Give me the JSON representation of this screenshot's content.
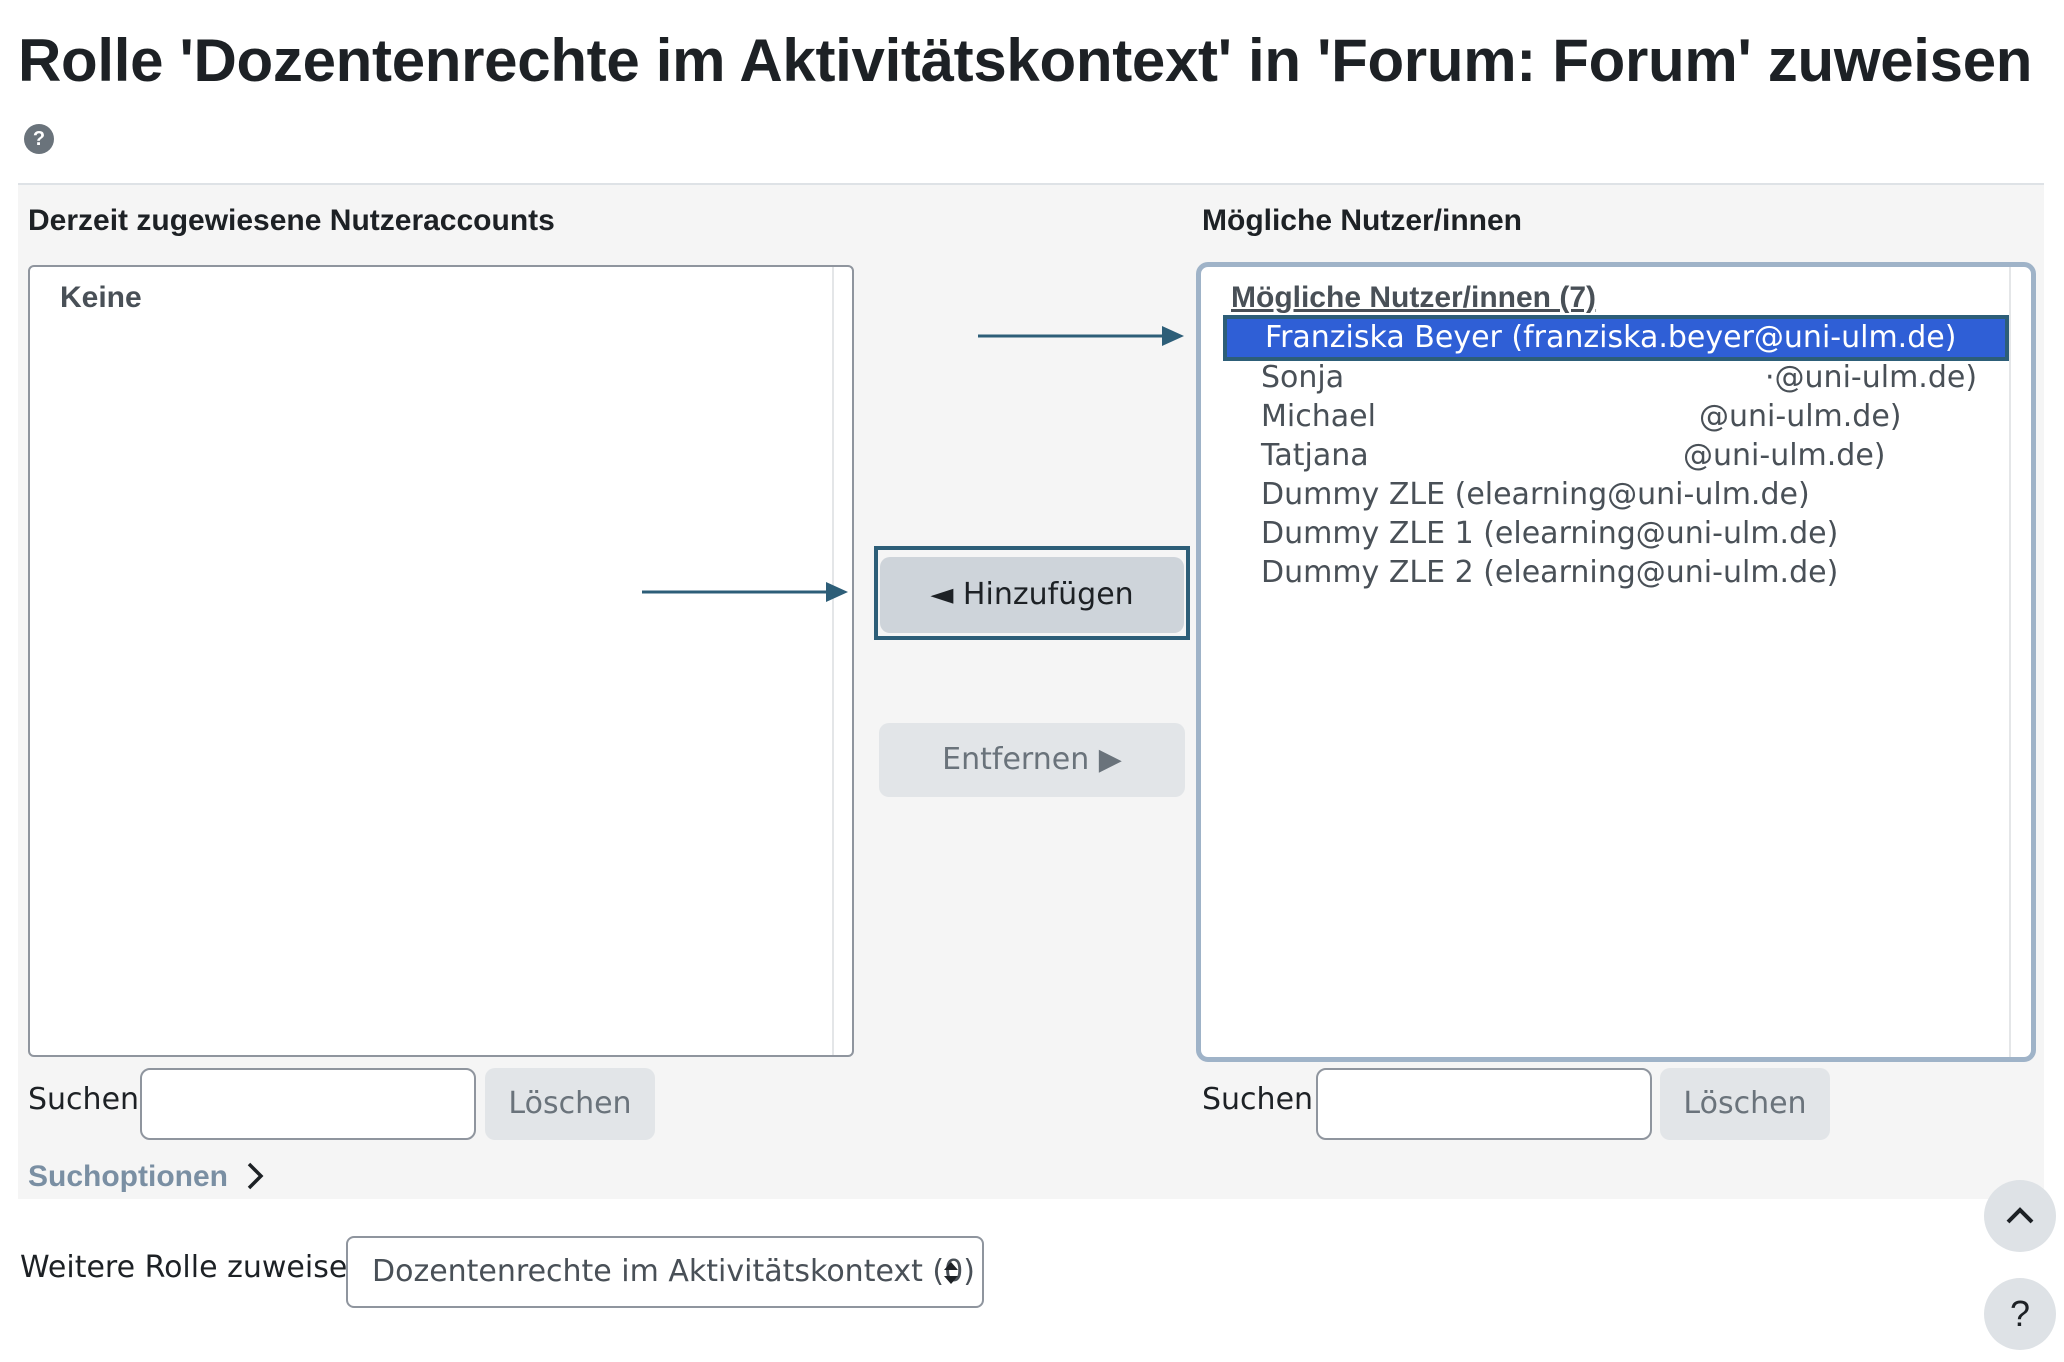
{
  "page": {
    "title": "Rolle 'Dozentenrechte im Aktivitätskontext' in 'Forum: Forum' zuweisen",
    "help_glyph": "?"
  },
  "current_users": {
    "heading": "Derzeit zugewiesene Nutzeraccounts",
    "empty_text": "Keine",
    "search_label": "Suchen",
    "search_value": "",
    "clear_label": "Löschen"
  },
  "potential_users": {
    "heading": "Mögliche Nutzer/innen",
    "group_label": "Mögliche Nutzer/innen (7)",
    "items": [
      {
        "name": "Franziska Beyer (franziska.beyer@uni-ulm.de)",
        "email": "",
        "selected": true
      },
      {
        "name": "Sonja",
        "email": "·@uni-ulm.de)",
        "selected": false
      },
      {
        "name": "Michael",
        "email": "@uni-ulm.de)",
        "selected": false
      },
      {
        "name": "Tatjana",
        "email": "@uni-ulm.de)",
        "selected": false
      },
      {
        "name": "Dummy ZLE (elearning@uni-ulm.de)",
        "email": "",
        "selected": false
      },
      {
        "name": "Dummy ZLE 1 (elearning@uni-ulm.de)",
        "email": "",
        "selected": false
      },
      {
        "name": "Dummy ZLE 2 (elearning@uni-ulm.de)",
        "email": "",
        "selected": false
      }
    ],
    "search_label": "Suchen",
    "search_value": "",
    "clear_label": "Löschen"
  },
  "actions": {
    "add_label": "◄ Hinzufügen",
    "remove_label": "Entfernen ▶"
  },
  "search_options_link": "Suchoptionen",
  "other_role": {
    "label": "Weitere Rolle zuweisen",
    "selected_value": "Dozentenrechte im Aktivitätskontext (0)"
  },
  "floating": {
    "help_glyph": "?"
  },
  "colors": {
    "selected_bg": "#2f5fd6",
    "annotation_arrow": "#2d5e78",
    "panel_bg": "#f5f5f5"
  }
}
